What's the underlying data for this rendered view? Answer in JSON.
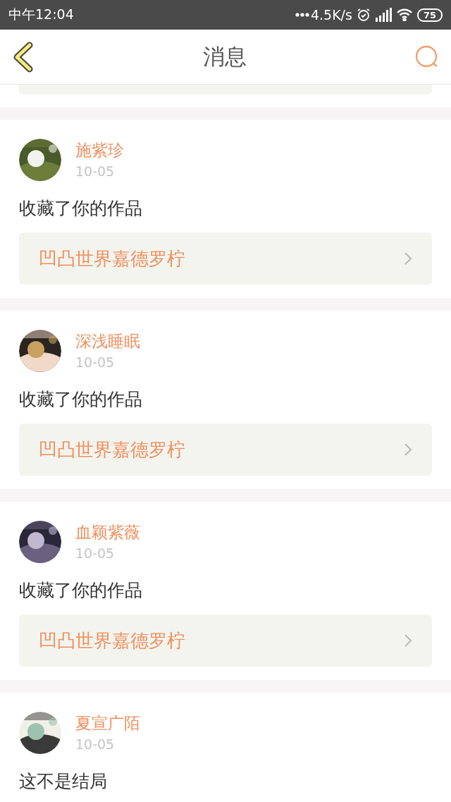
{
  "status_bar": {
    "time": "中午12:04",
    "speed": "4.5K/s",
    "battery": "75"
  },
  "header": {
    "title": "消息"
  },
  "messages": [
    {
      "name": "施紫珍",
      "date": "10-05",
      "text": "收藏了你的作品",
      "work": "凹凸世界嘉德罗柠"
    },
    {
      "name": "深浅睡眠",
      "date": "10-05",
      "text": "收藏了你的作品",
      "work": "凹凸世界嘉德罗柠"
    },
    {
      "name": "血颖紫薇",
      "date": "10-05",
      "text": "收藏了你的作品",
      "work": "凹凸世界嘉德罗柠"
    },
    {
      "name": "夏宣广陌",
      "date": "10-05",
      "text": "这不是结局"
    }
  ]
}
